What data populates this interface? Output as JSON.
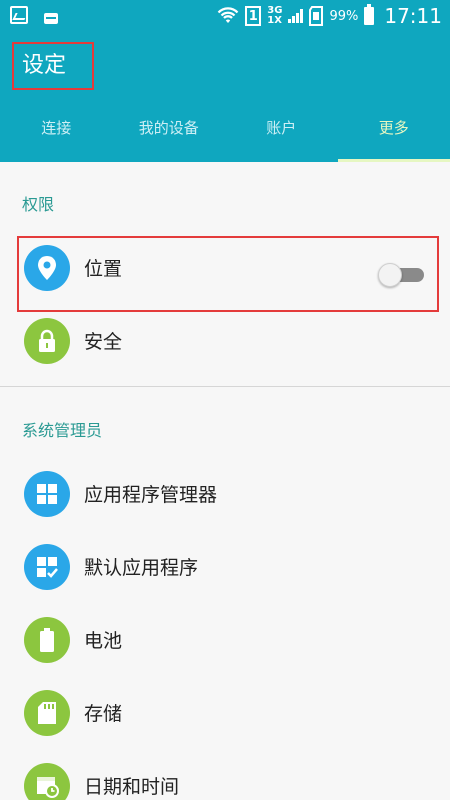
{
  "status_bar": {
    "network_3g": "3G",
    "network_1x": "1X",
    "sim_slot": "1",
    "battery_pct": "99%",
    "time": "17:11",
    "icons": [
      "image-icon",
      "message-icon",
      "wifi-icon",
      "sim-icon",
      "signal-icon",
      "sd-card-icon",
      "battery-icon"
    ]
  },
  "header": {
    "title": "设定",
    "tabs": [
      {
        "label": "连接",
        "active": false
      },
      {
        "label": "我的设备",
        "active": false
      },
      {
        "label": "账户",
        "active": false
      },
      {
        "label": "更多",
        "active": true
      }
    ]
  },
  "sections": {
    "permissions": {
      "label": "权限",
      "items": [
        {
          "label": "位置",
          "icon": "location-pin-icon",
          "color": "#2aa7e8",
          "toggle": {
            "on": false
          }
        },
        {
          "label": "安全",
          "icon": "lock-icon",
          "color": "#8cc63f"
        }
      ]
    },
    "system_admin": {
      "label": "系统管理员",
      "items": [
        {
          "label": "应用程序管理器",
          "icon": "app-grid-icon",
          "color": "#2aa7e8"
        },
        {
          "label": "默认应用程序",
          "icon": "default-apps-icon",
          "color": "#2aa7e8"
        },
        {
          "label": "电池",
          "icon": "battery-icon",
          "color": "#8cc63f"
        },
        {
          "label": "存储",
          "icon": "sd-card-icon",
          "color": "#8cc63f"
        },
        {
          "label": "日期和时间",
          "icon": "calendar-clock-icon",
          "color": "#8cc63f"
        }
      ]
    }
  },
  "colors": {
    "header_bg": "#0fa7bf",
    "accent_teal_text": "#2a9a93",
    "highlight_red": "#e43b3b",
    "page_bg": "#f7f7f7"
  }
}
